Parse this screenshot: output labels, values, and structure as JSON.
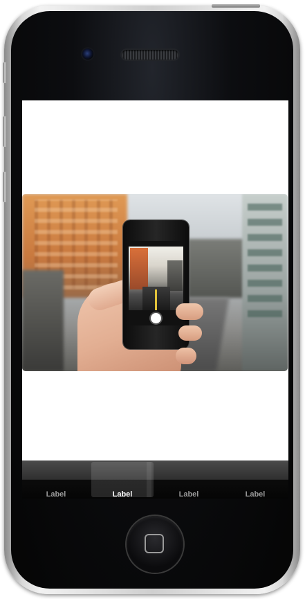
{
  "tabbar": {
    "tabs": [
      {
        "label": "Label",
        "selected": false
      },
      {
        "label": "Label",
        "selected": true
      },
      {
        "label": "Label",
        "selected": false
      },
      {
        "label": "Label",
        "selected": false
      }
    ]
  },
  "icons": [
    "camera-icon",
    "home-square-icon"
  ],
  "colors": {
    "tab_selected_label": "#ffffff",
    "tab_label": "#9a9a9a",
    "screen_background": "#ffffff"
  }
}
